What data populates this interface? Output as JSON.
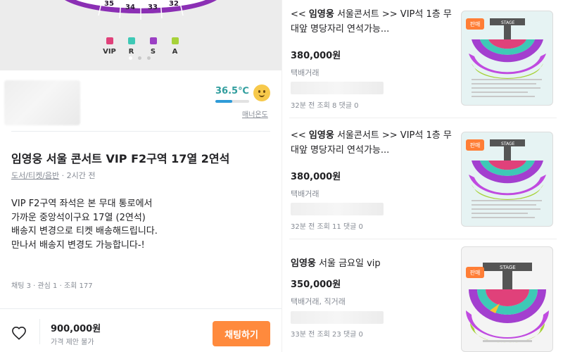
{
  "detail": {
    "hero": {
      "seat_numbers": [
        "35",
        "34",
        "33",
        "32"
      ],
      "legend": [
        {
          "label": "VIP",
          "color": "#e0417a"
        },
        {
          "label": "R",
          "color": "#3ec9b6"
        },
        {
          "label": "S",
          "color": "#9b3fc4"
        },
        {
          "label": "A",
          "color": "#a7d23a"
        }
      ]
    },
    "seller": {
      "temperature": "36.5℃",
      "temperature_level": 0.5,
      "manner_label": "매너온도"
    },
    "title": "임영웅 서울 콘서트 VIP F2구역 17열 2연석",
    "category": "도서/티켓/음반",
    "time": "· 2시간 전",
    "body": [
      "VIP F2구역 좌석은 본 무대 통로에서",
      "가까운 중앙석이구요 17열 (2연석)",
      "배송지 변경으로 티켓 배송해드립니다.",
      "만나서 배송지 변경도 가능합니다-!"
    ],
    "stats": "채팅 3 · 관심 1 · 조회 177",
    "price": "900,000원",
    "price_note": "가격 제안 불가",
    "chat_button": "채팅하기"
  },
  "listings": [
    {
      "title_pre": "<< ",
      "title_bold": "임영웅",
      "title_post": " 서울콘서트 >> VIP석 1층 무대앞 명당자리 연석가능...",
      "price": "380,000원",
      "trade": "택배거래",
      "stats": "32분 전   조회 8   댓글 0",
      "badge": "판매",
      "stage": "STAGE"
    },
    {
      "title_pre": "<< ",
      "title_bold": "임영웅",
      "title_post": " 서울콘서트 >> VIP석 1층 무대앞 명당자리 연석가능...",
      "price": "380,000원",
      "trade": "택배거래",
      "stats": "32분 전   조회 11   댓글 0",
      "badge": "판매",
      "stage": "STAGE"
    },
    {
      "title_pre": "",
      "title_bold": "임영웅",
      "title_post": " 서울 금요일 vip",
      "price": "350,000원",
      "trade": "택배거래, 직거래",
      "stats": "33분 전   조회 23   댓글 0",
      "badge": "판매",
      "stage": "STAGE"
    }
  ]
}
